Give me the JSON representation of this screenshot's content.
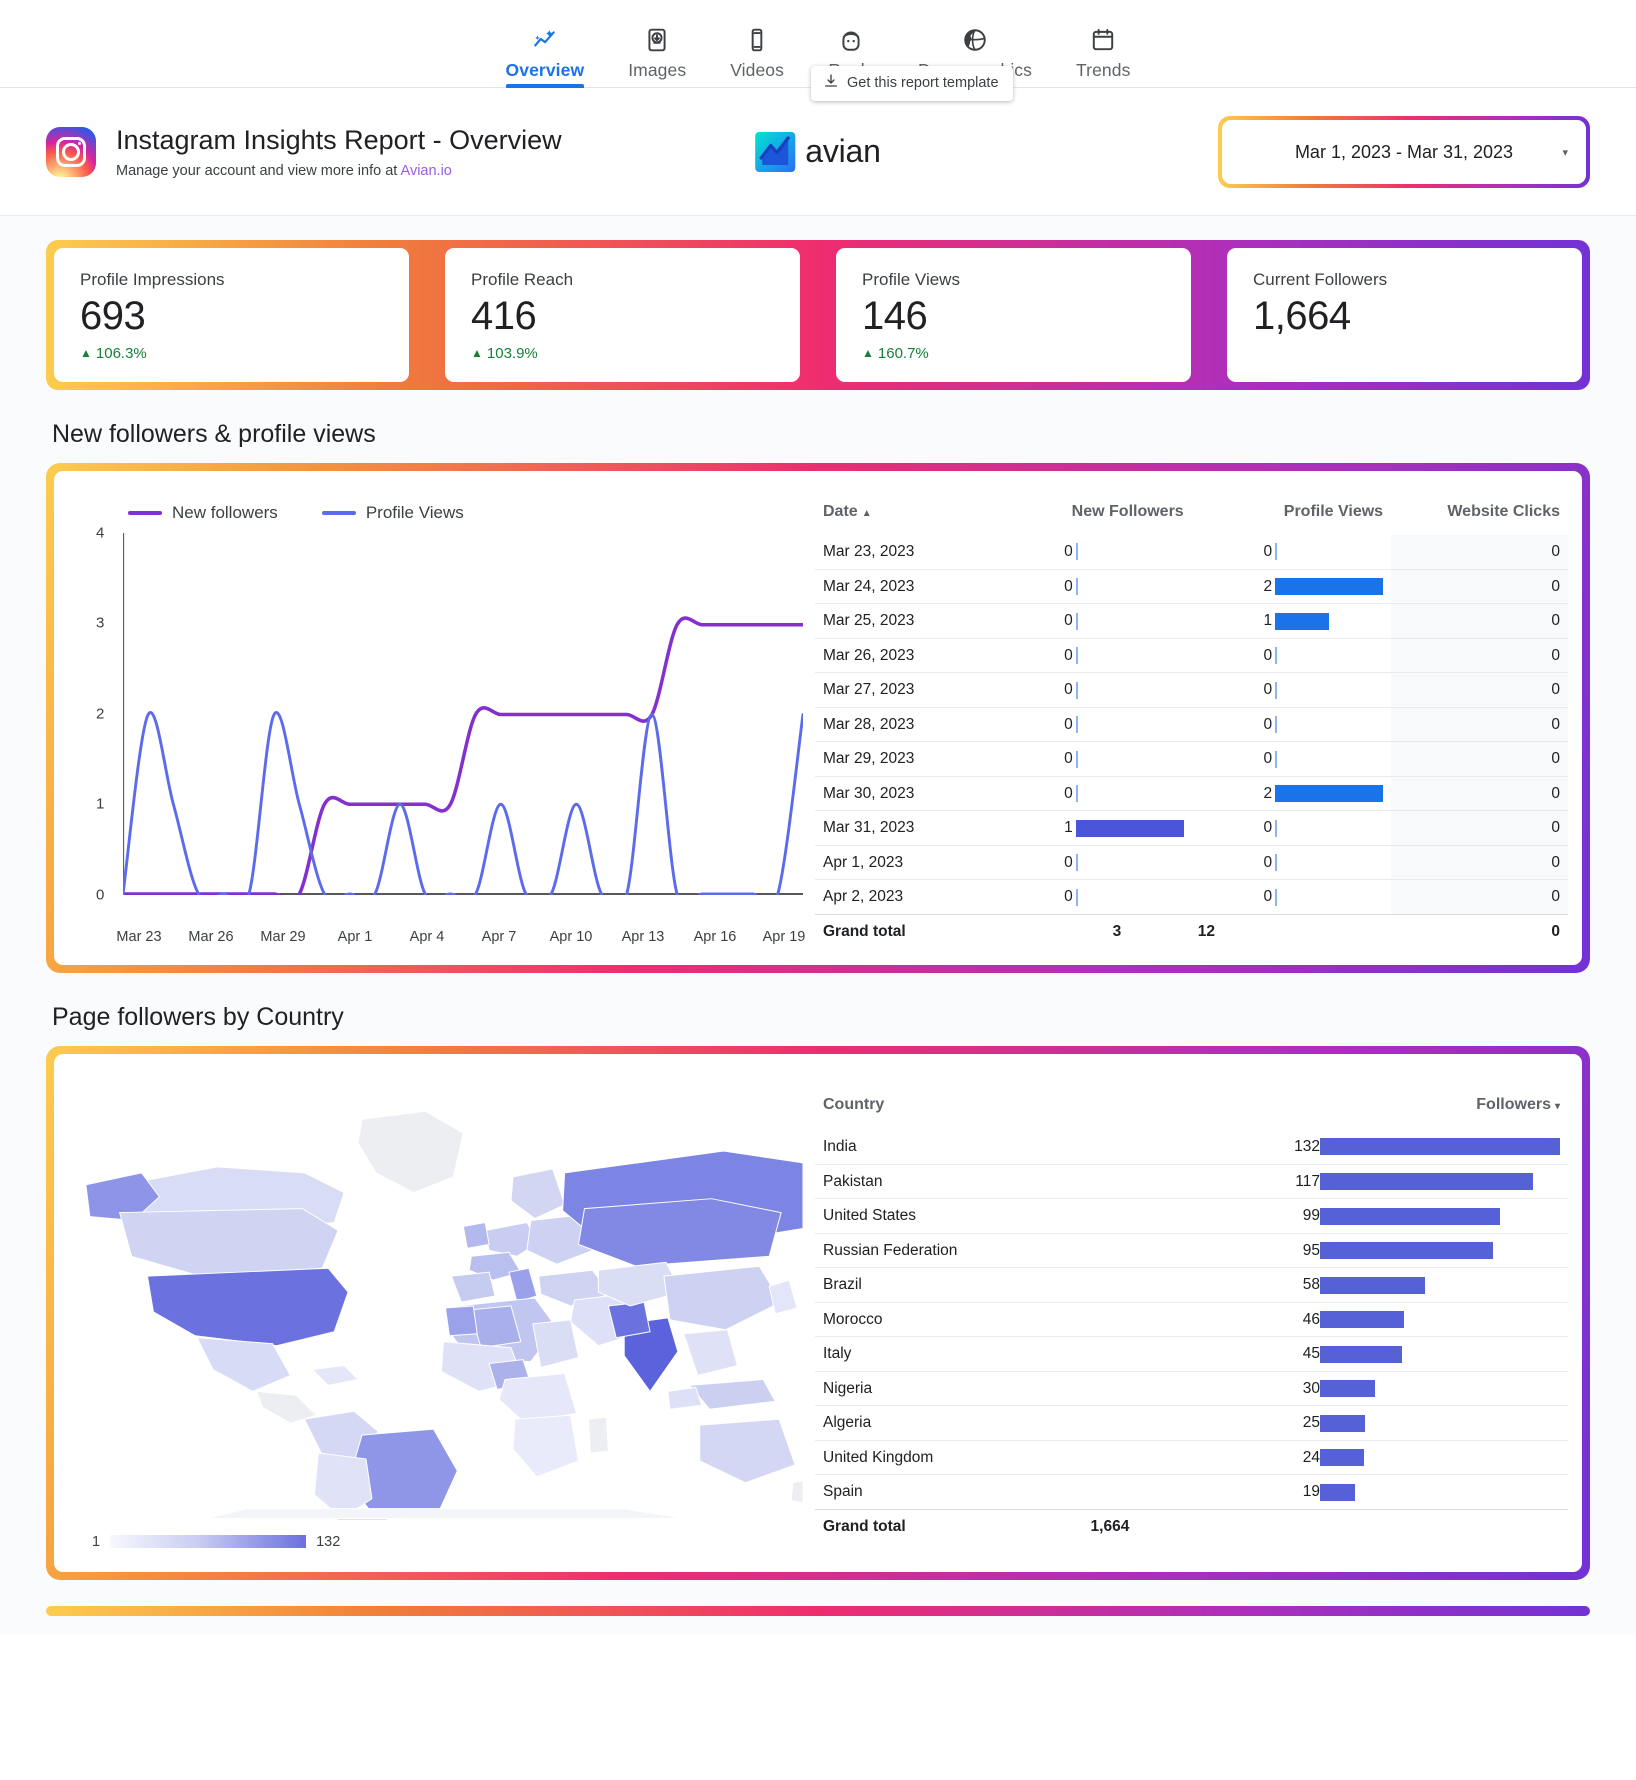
{
  "nav": {
    "items": [
      {
        "label": "Overview",
        "icon": "trend-sparkle-icon",
        "active": true
      },
      {
        "label": "Images",
        "icon": "image-download-icon",
        "active": false
      },
      {
        "label": "Videos",
        "icon": "mobile-video-icon",
        "active": false
      },
      {
        "label": "Reels",
        "icon": "face-icon",
        "active": false
      },
      {
        "label": "Demographics",
        "icon": "globe-icon",
        "active": false
      },
      {
        "label": "Trends",
        "icon": "calendar-icon",
        "active": false
      }
    ]
  },
  "header": {
    "title": "Instagram Insights Report - Overview",
    "subtitle_prefix": "Manage your account and view more info at ",
    "subtitle_link": "Avian.io",
    "brand_word": "avian",
    "template_button": "Get this report template",
    "date_range": "Mar 1, 2023 - Mar 31, 2023"
  },
  "kpis": [
    {
      "label": "Profile Impressions",
      "value": "693",
      "delta": "106.3%",
      "delta_dir": "up"
    },
    {
      "label": "Profile Reach",
      "value": "416",
      "delta": "103.9%",
      "delta_dir": "up"
    },
    {
      "label": "Profile Views",
      "value": "146",
      "delta": "160.7%",
      "delta_dir": "up"
    },
    {
      "label": "Current Followers",
      "value": "1,664",
      "delta": "",
      "delta_dir": ""
    }
  ],
  "followers_section": {
    "title": "New followers & profile views",
    "table": {
      "headers": [
        "Date",
        "New Followers",
        "Profile Views",
        "Website Clicks"
      ],
      "sort_column": "Date",
      "sort_dir": "asc",
      "rows": [
        {
          "date": "Mar 23, 2023",
          "new_followers": "0",
          "profile_views": "0",
          "website_clicks": "0"
        },
        {
          "date": "Mar 24, 2023",
          "new_followers": "0",
          "profile_views": "2",
          "website_clicks": "0"
        },
        {
          "date": "Mar 25, 2023",
          "new_followers": "0",
          "profile_views": "1",
          "website_clicks": "0"
        },
        {
          "date": "Mar 26, 2023",
          "new_followers": "0",
          "profile_views": "0",
          "website_clicks": "0"
        },
        {
          "date": "Mar 27, 2023",
          "new_followers": "0",
          "profile_views": "0",
          "website_clicks": "0"
        },
        {
          "date": "Mar 28, 2023",
          "new_followers": "0",
          "profile_views": "0",
          "website_clicks": "0"
        },
        {
          "date": "Mar 29, 2023",
          "new_followers": "0",
          "profile_views": "0",
          "website_clicks": "0"
        },
        {
          "date": "Mar 30, 2023",
          "new_followers": "0",
          "profile_views": "2",
          "website_clicks": "0"
        },
        {
          "date": "Mar 31, 2023",
          "new_followers": "1",
          "profile_views": "0",
          "website_clicks": "0"
        },
        {
          "date": "Apr 1, 2023",
          "new_followers": "0",
          "profile_views": "0",
          "website_clicks": "0"
        },
        {
          "date": "Apr 2, 2023",
          "new_followers": "0",
          "profile_views": "0",
          "website_clicks": "0"
        }
      ],
      "total_label": "Grand total",
      "total_new_followers": "3",
      "total_profile_views": "12",
      "total_website_clicks": "0"
    }
  },
  "country_section": {
    "title": "Page followers by Country",
    "map_legend_min": "1",
    "map_legend_max": "132",
    "table": {
      "headers": [
        "Country",
        "Followers"
      ],
      "sort_column": "Followers",
      "sort_dir": "desc",
      "rows": [
        {
          "country": "India",
          "followers": "132"
        },
        {
          "country": "Pakistan",
          "followers": "117"
        },
        {
          "country": "United States",
          "followers": "99"
        },
        {
          "country": "Russian Federation",
          "followers": "95"
        },
        {
          "country": "Brazil",
          "followers": "58"
        },
        {
          "country": "Morocco",
          "followers": "46"
        },
        {
          "country": "Italy",
          "followers": "45"
        },
        {
          "country": "Nigeria",
          "followers": "30"
        },
        {
          "country": "Algeria",
          "followers": "25"
        },
        {
          "country": "United Kingdom",
          "followers": "24"
        },
        {
          "country": "Spain",
          "followers": "19"
        }
      ],
      "total_label": "Grand total",
      "total_followers": "1,664"
    }
  },
  "colors": {
    "new_followers_line": "#8430ce",
    "profile_views_line": "#5c6bec",
    "table_bar_blue": "#1a73e8",
    "table_bar_indigo": "#4a54d8",
    "country_bar": "#5761d7",
    "accent_blue": "#1a73e8",
    "positive_green": "#188038"
  },
  "chart_data": {
    "type": "line",
    "title": "New followers & profile views",
    "xlabel": "",
    "ylabel": "",
    "ylim": [
      0,
      4
    ],
    "yticks": [
      0,
      1,
      2,
      3,
      4
    ],
    "xticks": [
      "Mar 23",
      "Mar 26",
      "Mar 29",
      "Apr 1",
      "Apr 4",
      "Apr 7",
      "Apr 10",
      "Apr 13",
      "Apr 16",
      "Apr 19"
    ],
    "x": [
      "Mar 23",
      "Mar 24",
      "Mar 25",
      "Mar 26",
      "Mar 27",
      "Mar 28",
      "Mar 29",
      "Mar 30",
      "Mar 31",
      "Apr 1",
      "Apr 2",
      "Apr 3",
      "Apr 4",
      "Apr 5",
      "Apr 6",
      "Apr 7",
      "Apr 8",
      "Apr 9",
      "Apr 10",
      "Apr 11",
      "Apr 12",
      "Apr 13",
      "Apr 14",
      "Apr 15",
      "Apr 16",
      "Apr 17",
      "Apr 18",
      "Apr 19"
    ],
    "grid": false,
    "legend_position": "top-left",
    "series": [
      {
        "name": "New followers",
        "color": "#8430ce",
        "values": [
          0,
          0,
          0,
          0,
          0,
          0,
          0,
          0,
          1,
          1,
          1,
          1,
          1,
          1,
          2,
          2,
          2,
          2,
          2,
          2,
          2,
          2,
          3,
          3,
          3,
          3,
          3,
          3
        ]
      },
      {
        "name": "Profile Views",
        "color": "#5c6bec",
        "values": [
          0,
          2,
          1,
          0,
          0,
          0,
          2,
          1,
          0,
          0,
          0,
          1,
          0,
          0,
          0,
          1,
          0,
          0,
          1,
          0,
          0,
          2,
          0,
          0,
          0,
          0,
          0,
          2
        ]
      }
    ]
  }
}
